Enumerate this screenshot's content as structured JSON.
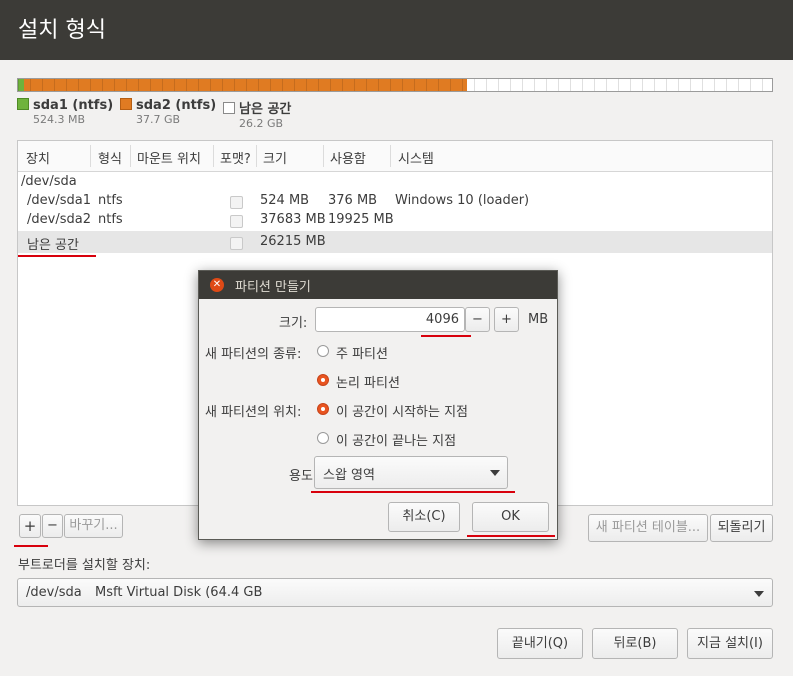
{
  "window": {
    "title": "설치 형식"
  },
  "partition_bar": {
    "segments": [
      {
        "name": "sda1",
        "color": "#6fb33c",
        "fraction": 0.0082
      },
      {
        "name": "sda2",
        "color": "#e07b22",
        "fraction": 0.5875
      },
      {
        "name": "free",
        "color": "#ffffff",
        "fraction": 0.4043
      }
    ]
  },
  "legend": [
    {
      "name": "sda1 (ntfs)",
      "size": "524.3 MB",
      "color": "#6fb33c"
    },
    {
      "name": "sda2 (ntfs)",
      "size": "37.7 GB",
      "color": "#e07b22"
    },
    {
      "name": "남은 공간",
      "size": "26.2 GB",
      "color": "#ffffff"
    }
  ],
  "table": {
    "columns": [
      "장치",
      "형식",
      "마운트 위치",
      "포맷?",
      "크기",
      "사용함",
      "시스템"
    ],
    "rows": [
      {
        "device": "/dev/sda",
        "type": "",
        "size": "",
        "used": "",
        "system": ""
      },
      {
        "device": "/dev/sda1",
        "type": "ntfs",
        "size": "524 MB",
        "used": "376 MB",
        "system": "Windows 10 (loader)"
      },
      {
        "device": "/dev/sda2",
        "type": "ntfs",
        "size": "37683 MB",
        "used": "19925 MB",
        "system": ""
      },
      {
        "device": "남은 공간",
        "type": "",
        "size": "26215 MB",
        "used": "",
        "system": ""
      }
    ]
  },
  "toolbar": {
    "add": "+",
    "remove": "−",
    "change": "바꾸기...",
    "new_table": "새 파티션 테이블...",
    "revert": "되돌리기"
  },
  "bootloader": {
    "label": "부트로더를 설치할 장치:",
    "device": "/dev/sda",
    "desc": "Msft Virtual Disk (64.4 GB"
  },
  "footer": {
    "quit": "끝내기(Q)",
    "back": "뒤로(B)",
    "install": "지금 설치(I)"
  },
  "dialog": {
    "title": "파티션 만들기",
    "size_label": "크기:",
    "size_value": "4096",
    "minus": "−",
    "plus": "+",
    "unit": "MB",
    "type_label": "새 파티션의 종류:",
    "type_primary": "주 파티션",
    "type_logical": "논리 파티션",
    "type_selected": "logical",
    "location_label": "새 파티션의 위치:",
    "loc_begin": "이 공간이 시작하는 지점",
    "loc_end": "이 공간이 끝나는 지점",
    "location_selected": "begin",
    "use_label": "용도:",
    "use_value": "스왑 영역",
    "cancel": "취소(C)",
    "ok": "OK"
  },
  "annotation_color": "#d8000c"
}
